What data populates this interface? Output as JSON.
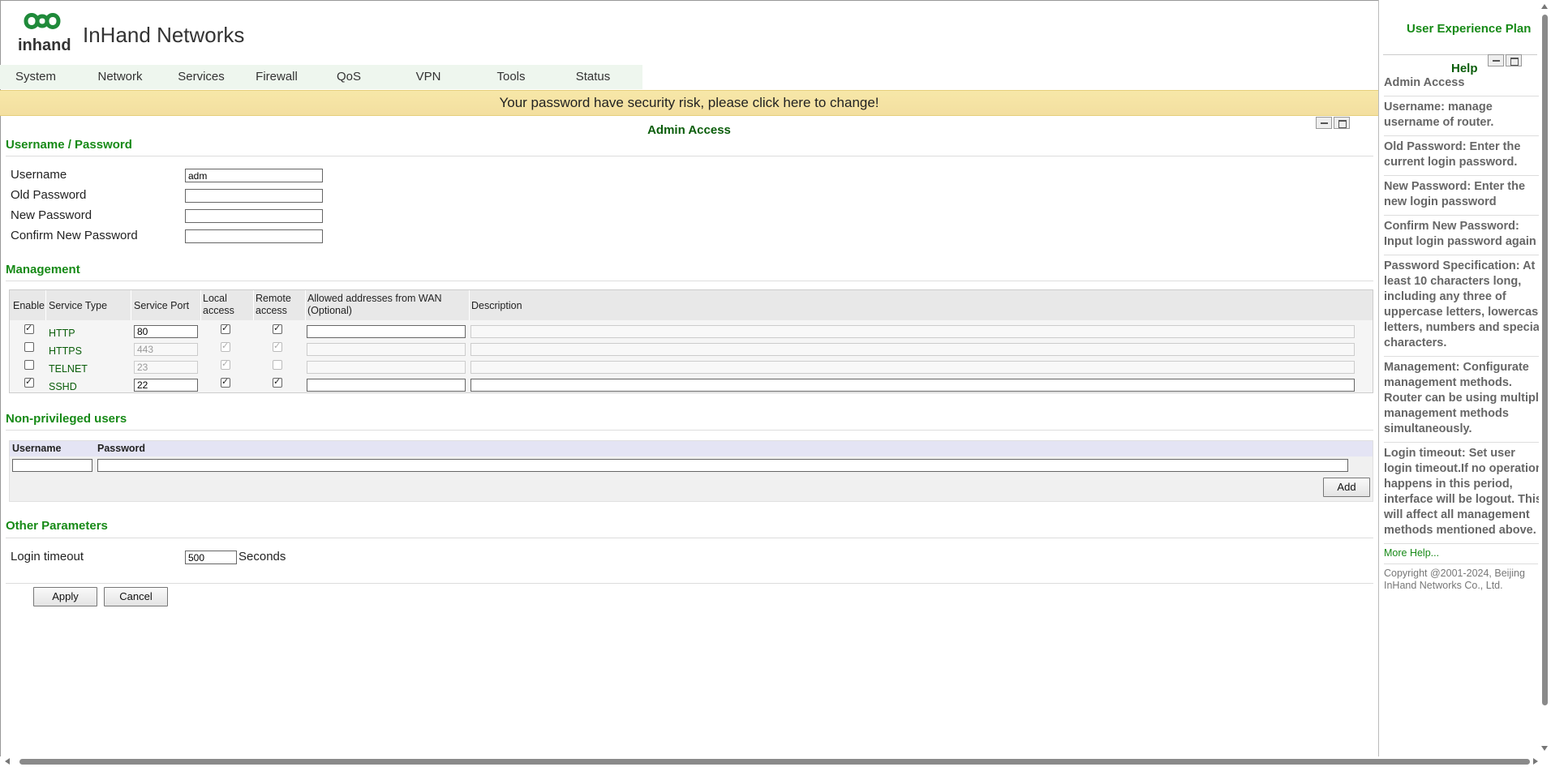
{
  "brand": {
    "name": "InHand Networks",
    "logo_text": "inhand"
  },
  "nav": {
    "items": [
      "System",
      "Network",
      "Services",
      "Firewall",
      "QoS",
      "VPN",
      "Tools",
      "Status"
    ]
  },
  "banner": {
    "text": "Your password have security risk, please click here to change!"
  },
  "page": {
    "title": "Admin Access"
  },
  "userpass": {
    "title": "Username / Password",
    "username_label": "Username",
    "username_value": "adm",
    "old_label": "Old Password",
    "new_label": "New Password",
    "confirm_label": "Confirm New Password"
  },
  "management": {
    "title": "Management",
    "headers": {
      "enable": "Enable",
      "service_type": "Service Type",
      "service_port": "Service Port",
      "local_1": "Local",
      "local_2": "access",
      "remote_1": "Remote",
      "remote_2": "access",
      "allowed_1": "Allowed addresses from WAN",
      "allowed_2": "(Optional)",
      "description": "Description"
    },
    "rows": [
      {
        "enable": true,
        "service": "HTTP",
        "port": "80",
        "local": true,
        "remote": true,
        "disabled": false
      },
      {
        "enable": false,
        "service": "HTTPS",
        "port": "443",
        "local": true,
        "remote": true,
        "disabled": true
      },
      {
        "enable": false,
        "service": "TELNET",
        "port": "23",
        "local": true,
        "remote": false,
        "disabled": true
      },
      {
        "enable": true,
        "service": "SSHD",
        "port": "22",
        "local": true,
        "remote": true,
        "disabled": false
      }
    ]
  },
  "nonpriv": {
    "title": "Non-privileged users",
    "username_header": "Username",
    "password_header": "Password",
    "add_label": "Add"
  },
  "other": {
    "title": "Other Parameters",
    "timeout_label": "Login timeout",
    "timeout_value": "500",
    "timeout_unit": "Seconds"
  },
  "buttons": {
    "apply": "Apply",
    "cancel": "Cancel"
  },
  "help": {
    "ux_plan": "User Experience Plan",
    "title": "Help",
    "heading": "Admin Access",
    "paragraphs": [
      "Username: manage username of router.",
      "Old Password: Enter the current login password.",
      "New Password: Enter the new login password",
      "Confirm New Password: Input login password again",
      "Password Specification: At least 10 characters long, including any three of uppercase letters, lowercase letters, numbers and special characters.",
      "Management: Configurate management methods. Router can be using multiple management methods simultaneously.",
      "Login timeout: Set user login timeout.If no operation happens in this period, interface will be logout. This will affect all management methods mentioned above."
    ],
    "more": "More Help...",
    "copyright": "Copyright @2001-2024, Beijing InHand Networks Co., Ltd."
  },
  "colors": {
    "accent_green": "#178a17",
    "banner": "#f5e3a5",
    "nav_bg": "#eef6ee"
  }
}
